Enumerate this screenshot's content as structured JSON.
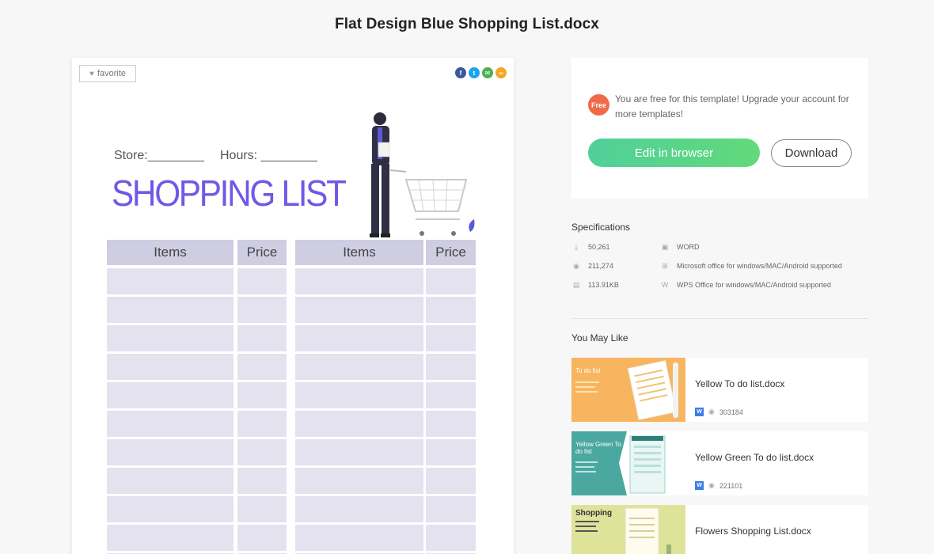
{
  "page": {
    "title": "Flat Design Blue Shopping List.docx"
  },
  "preview": {
    "favorite_label": "favorite",
    "share_icons": [
      "facebook-icon",
      "twitter-icon",
      "email-icon",
      "link-icon"
    ],
    "document": {
      "store_label": "Store:________",
      "hours_label": "Hours: ________",
      "heading": "SHOPPING LIST",
      "columns": [
        "Items",
        "Price",
        "Items",
        "Price"
      ],
      "heading_color": "#6e5ae6",
      "header_color": "#cfcde2",
      "cell_color": "#e4e2ef"
    }
  },
  "actions": {
    "free_badge": "Free",
    "free_text": "You are free for this template! Upgrade your account for more templates!",
    "edit_label": "Edit in browser",
    "download_label": "Download"
  },
  "specifications": {
    "title": "Specifications",
    "downloads": "50,261",
    "views": "211,274",
    "size": "113.91KB",
    "format": "WORD",
    "compat_ms": "Microsoft office for windows/MAC/Android supported",
    "compat_wps": "WPS Office for windows/MAC/Android supported"
  },
  "you_may_like": {
    "title": "You May Like",
    "items": [
      {
        "name": "Yellow To do list.docx",
        "views": "303184",
        "thumb_text": "To do list",
        "thumb_color": "#f8b560"
      },
      {
        "name": "Yellow Green To do list.docx",
        "views": "221101",
        "thumb_text": "Yellow Green To do list",
        "thumb_color": "#4aa8a0"
      },
      {
        "name": "Flowers Shopping List.docx",
        "views": "",
        "thumb_text": "Shopping",
        "thumb_color": "#dfe39a"
      }
    ]
  }
}
